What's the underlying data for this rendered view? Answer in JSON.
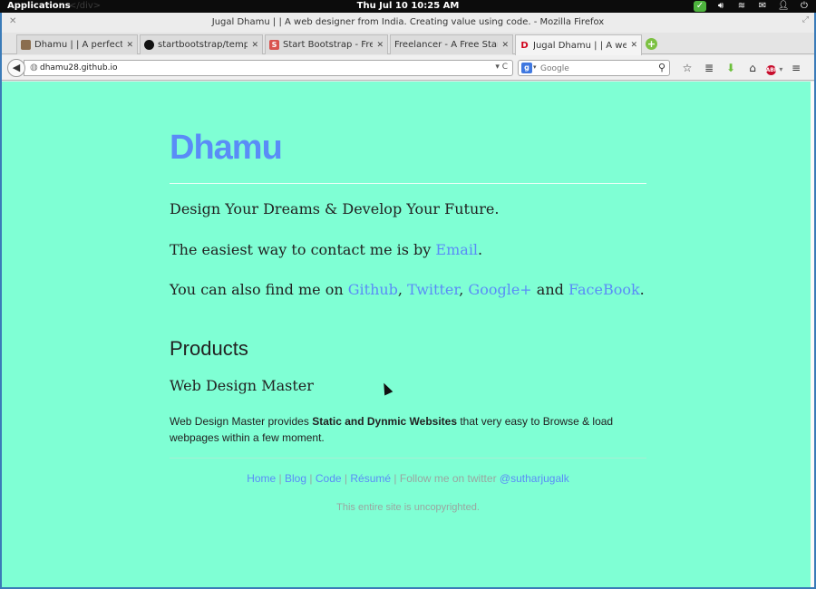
{
  "system_panel": {
    "applications": "Applications",
    "ghost_text": "</div>",
    "clock": "Thu Jul 10 10:25 AM"
  },
  "window": {
    "title": "Jugal Dhamu | | A web designer from India. Creating value using code. - Mozilla Firefox"
  },
  "tabs": [
    {
      "label": "Dhamu | | A perfect web d...",
      "icon": "photo-favicon"
    },
    {
      "label": "startbootstrap/templates/f...",
      "icon": "github-icon"
    },
    {
      "label": "Start Bootstrap - Free Resp...",
      "icon": "startbootstrap-icon"
    },
    {
      "label": "Freelancer - A Free Start Bootst...",
      "icon": "none"
    },
    {
      "label": "Jugal Dhamu | | A web des...",
      "icon": "d-favicon",
      "active": true
    }
  ],
  "navbar": {
    "url": "dhamu28.github.io",
    "search_placeholder": "Google"
  },
  "page": {
    "brand": "Dhamu",
    "tagline": "Design Your Dreams & Develop Your Future.",
    "contact_prefix": "The easiest way to contact me is by ",
    "contact_link": "Email",
    "contact_suffix": ".",
    "find_prefix": "You can also find me on ",
    "links": {
      "github": "Github",
      "twitter": "Twitter",
      "googleplus": "Google+",
      "and": " and ",
      "facebook": "FaceBook"
    },
    "find_suffix": ".",
    "products_heading": "Products",
    "product_name": "Web Design Master",
    "desc_prefix": "Web Design Master provides ",
    "desc_bold": "Static and Dynmic Websites",
    "desc_suffix": " that very easy to Browse & load webpages within a few moment.",
    "footer": {
      "home": "Home",
      "blog": "Blog",
      "code": "Code",
      "resume": "Résumé",
      "follow_text": "Follow me on twitter",
      "handle": "@sutharjugalk"
    },
    "copyright": "This entire site is uncopyrighted."
  },
  "colors": {
    "background": "#7fffd4",
    "link": "#5a8cf7"
  }
}
